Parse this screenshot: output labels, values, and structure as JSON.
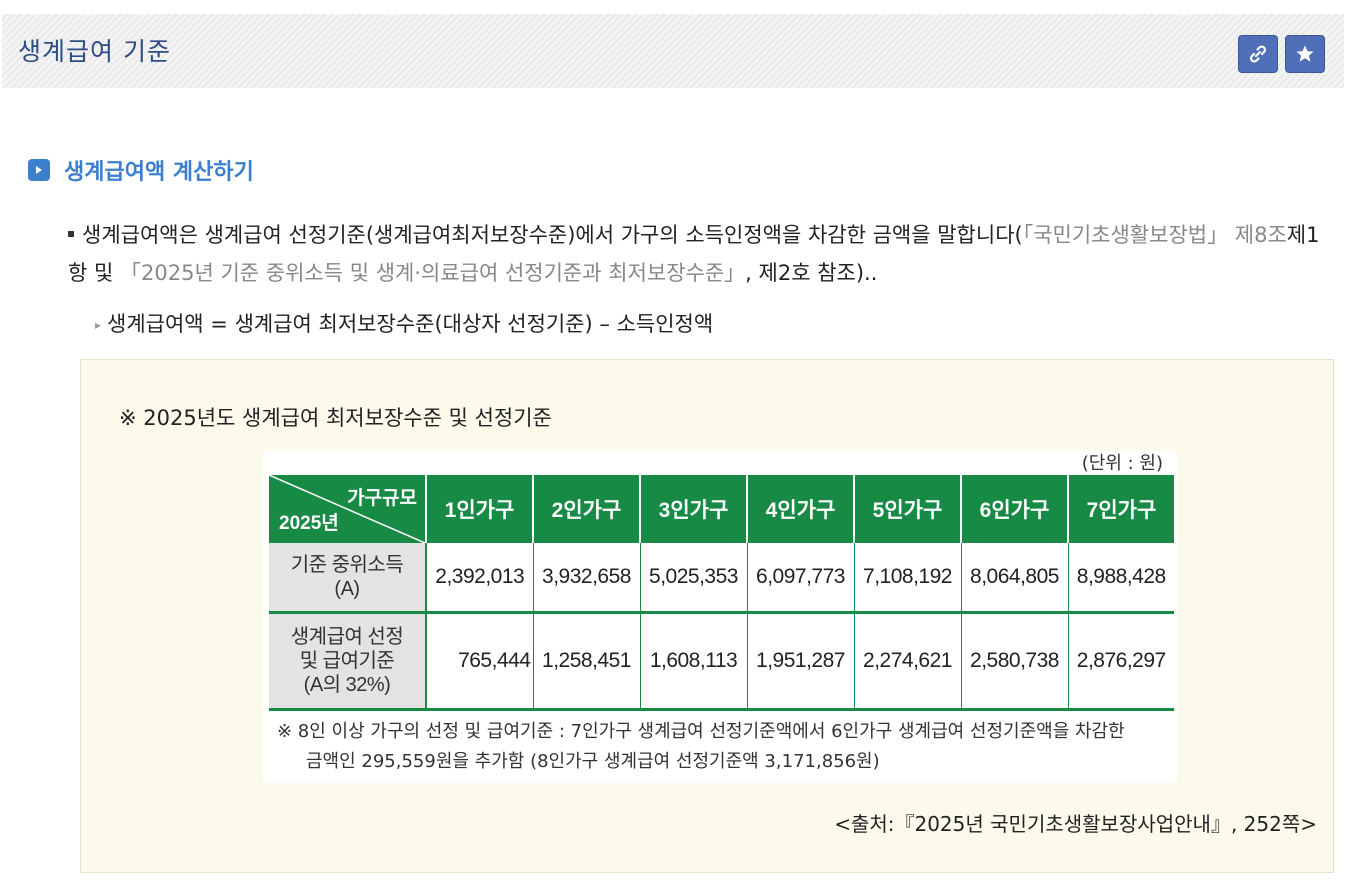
{
  "header": {
    "title": "생계급여 기준",
    "link_icon": "link-icon",
    "star_icon": "star-icon",
    "accent": "#4f6fb8"
  },
  "section": {
    "title": "생계급여액 계산하기",
    "icon": "play-arrow-icon",
    "accent": "#3d7fcf"
  },
  "paragraph": {
    "part1": "생계급여액은 생계급여 선정기준(생계급여최저보장수준)에서 가구의 소득인정액을 차감한 금액을 말합니다(",
    "cite1": "「국민기초생활보장법」 제8조",
    "part2": "제1항 및 ",
    "cite2": "「2025년 기준 중위소득 및 생계·의료급여 선정기준과 최저보장수준」",
    "part3": ", 제2호 참조).."
  },
  "formula": "생계급여액 = 생계급여 최저보장수준(대상자 선정기준) – 소득인정액",
  "box": {
    "title": "※ 2025년도 생계급여 최저보장수준 및 선정기준",
    "unit": "(단위 : 원)",
    "table": {
      "corner_top": "가구규모",
      "corner_bottom": "2025년",
      "columns": [
        "1인가구",
        "2인가구",
        "3인가구",
        "4인가구",
        "5인가구",
        "6인가구",
        "7인가구"
      ],
      "rows": [
        {
          "label_line1": "기준 중위소득",
          "label_line2": "(A)",
          "label_line3": "",
          "values": [
            "2,392,013",
            "3,932,658",
            "5,025,353",
            "6,097,773",
            "7,108,192",
            "8,064,805",
            "8,988,428"
          ]
        },
        {
          "label_line1": "생계급여 선정",
          "label_line2": "및 급여기준",
          "label_line3": "(A의 32%)",
          "values": [
            "765,444",
            "1,258,451",
            "1,608,113",
            "1,951,287",
            "2,274,621",
            "2,580,738",
            "2,876,297"
          ]
        }
      ],
      "header_color": "#178a46"
    },
    "note_line1": "※  8인 이상 가구의 선정 및 급여기준 : 7인가구 생계급여 선정기준액에서 6인가구 생계급여 선정기준액을 차감한",
    "note_line2": "금액인 295,559원을 추가함 (8인가구 생계급여 선정기준액 3,171,856원)",
    "source": "<출처:『2025년 국민기초생활보장사업안내』, 252쪽>"
  }
}
